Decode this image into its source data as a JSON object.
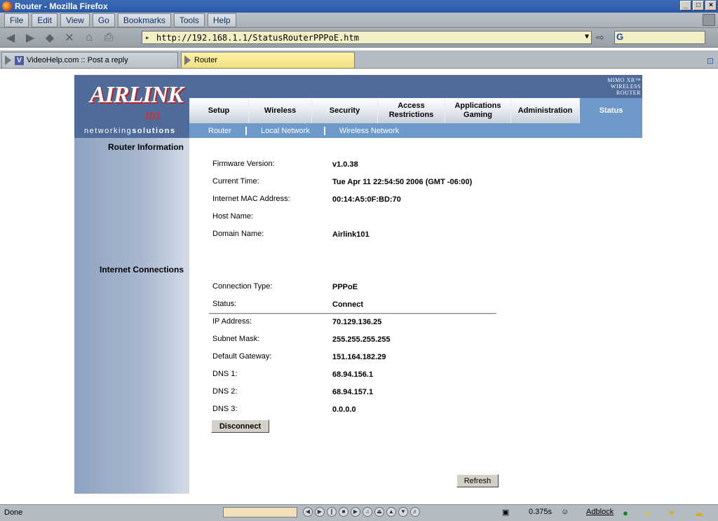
{
  "window": {
    "title": "Router - Mozilla Firefox",
    "buttons": [
      "_",
      "□",
      "×"
    ]
  },
  "menu": [
    "File",
    "Edit",
    "View",
    "Go",
    "Bookmarks",
    "Tools",
    "Help"
  ],
  "nav": {
    "url": "http://192.168.1.1/StatusRouterPPPoE.htm",
    "search_engine": "G"
  },
  "tabs": [
    {
      "label": "VideoHelp.com :: Post a reply",
      "active": false
    },
    {
      "label": "Router",
      "active": true
    }
  ],
  "router": {
    "logo_text": "AIRLINK",
    "logo_number": "101",
    "tagline_normal": "networking",
    "tagline_bold": "solutions",
    "mimo_line1": "MIMO XR™",
    "mimo_line2": "WIRELESS ROUTER",
    "main_tabs": [
      {
        "label": "Setup",
        "active": false
      },
      {
        "label": "Wireless",
        "active": false
      },
      {
        "label": "Security",
        "active": false
      },
      {
        "label": "Access Restrictions",
        "active": false
      },
      {
        "label": "Applications Gaming",
        "active": false
      },
      {
        "label": "Administration",
        "active": false
      },
      {
        "label": "Status",
        "active": true
      }
    ],
    "sub_tabs": [
      "Router",
      "Local Network",
      "Wireless Network"
    ],
    "router_info": {
      "heading": "Router Information",
      "rows": [
        {
          "label": "Firmware Version:",
          "value": "v1.0.38"
        },
        {
          "label": "Current Time:",
          "value": "Tue Apr 11 22:54:50 2006 (GMT -06:00)"
        },
        {
          "label": "Internet MAC Address:",
          "value": "00:14:A5:0F:BD:70"
        },
        {
          "label": "Host Name:",
          "value": ""
        },
        {
          "label": "Domain Name:",
          "value": "Airlink101"
        }
      ]
    },
    "internet": {
      "heading": "Internet Connections",
      "rows": [
        {
          "label": "Connection Type:",
          "value": "PPPoE"
        },
        {
          "label": "Status:",
          "value": "Connect"
        },
        {
          "label": "IP Address:",
          "value": "70.129.136.25"
        },
        {
          "label": "Subnet Mask:",
          "value": "255.255.255.255"
        },
        {
          "label": "Default Gateway:",
          "value": "151.164.182.29"
        },
        {
          "label": "DNS 1:",
          "value": "68.94.156.1"
        },
        {
          "label": "DNS 2:",
          "value": "68.94.157.1"
        },
        {
          "label": "DNS 3:",
          "value": "0.0.0.0"
        }
      ]
    },
    "disconnect_label": "Disconnect",
    "refresh_label": "Refresh"
  },
  "status_bar": {
    "text": "Done",
    "timer": "0.375s",
    "adblock": "Adblock"
  }
}
